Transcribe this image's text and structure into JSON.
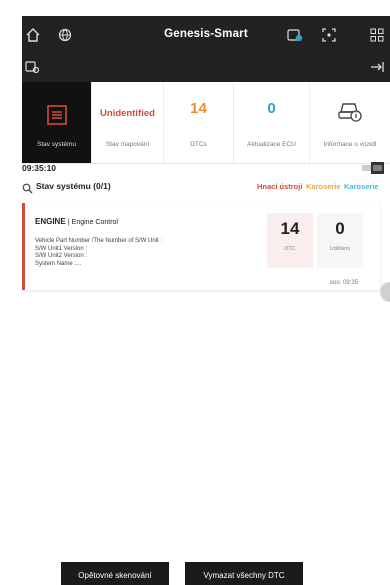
{
  "app": {
    "title": "Genesis-Smart"
  },
  "tabs": [
    {
      "caption": "Stav systému",
      "icon": "system-status-icon"
    },
    {
      "value": "Unidentified",
      "caption": "Stav mapování",
      "color": "#d44a3c"
    },
    {
      "value": "14",
      "caption": "DTCs",
      "color": "#f28a2e"
    },
    {
      "value": "0",
      "caption": "Aktualizace ECU",
      "color": "#2aa3c9"
    },
    {
      "caption": "Informace o vozidl",
      "icon": "vehicle-info-icon"
    }
  ],
  "timeline": {
    "time": "09:35:10"
  },
  "filter": {
    "label": "Stav systému (0/1)",
    "options": [
      {
        "label": "Hnací ústrojí",
        "color": "#d44a3c"
      },
      {
        "label": "Karoserie",
        "color": "#e0a94a"
      },
      {
        "label": "Karoserie",
        "color": "#4ab6d8"
      }
    ]
  },
  "ecu": {
    "name": "ENGINE",
    "system": "Engine Control",
    "info": [
      "Vehicle Part Number /The Number of S/W Unit :",
      "S/W Unit1 Version :",
      "S/W Unit2 Version :",
      "System Name :..."
    ],
    "dtc_count": "14",
    "dtc_caption": "DTC",
    "erased_count": "0",
    "erased_caption": "Uděláno",
    "stamp": "ooo. 09:35"
  },
  "buttons": {
    "rescan": "Opětovné skenování",
    "clear": "Vymazat všechny DTC"
  }
}
